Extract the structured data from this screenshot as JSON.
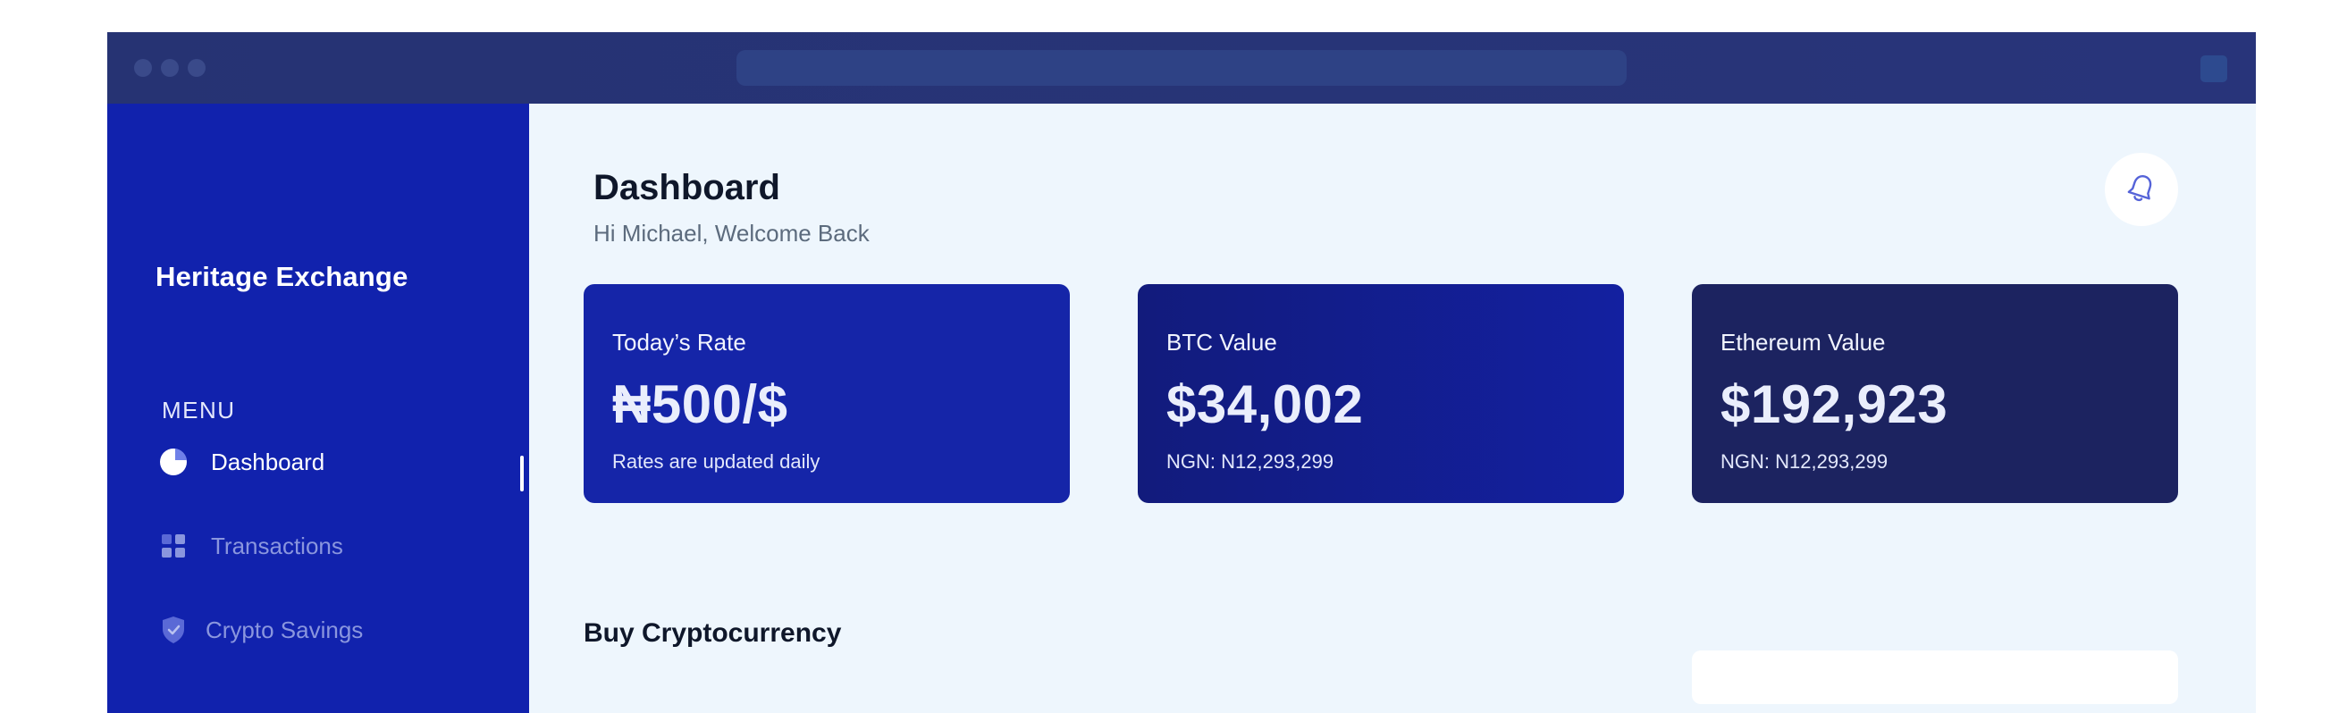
{
  "app": {
    "brand": "Heritage Exchange"
  },
  "sidebar": {
    "menu_label": "MENU",
    "items": [
      {
        "label": "Dashboard",
        "icon": "pie-chart-icon",
        "active": true
      },
      {
        "label": "Transactions",
        "icon": "grid-icon",
        "active": false
      },
      {
        "label": "Crypto Savings",
        "icon": "shield-check-icon",
        "active": false
      }
    ]
  },
  "header": {
    "title": "Dashboard",
    "welcome": "Hi Michael, Welcome Back",
    "notification_icon": "bell-icon"
  },
  "cards": [
    {
      "label": "Today’s Rate",
      "value": "₦500/$",
      "sub": "Rates are updated daily"
    },
    {
      "label": "BTC Value",
      "value": "$34,002",
      "sub": "NGN: N12,293,299"
    },
    {
      "label": "Ethereum Value",
      "value": "$192,923",
      "sub": "NGN: N12,293,299"
    }
  ],
  "sections": {
    "buy_title": "Buy Cryptocurrency"
  },
  "colors": {
    "sidebar": "#1122ad",
    "main_bg": "#eef6fd",
    "card_rate": "#1525a8",
    "card_btc": "#121b7c",
    "card_eth": "#1c2360"
  }
}
